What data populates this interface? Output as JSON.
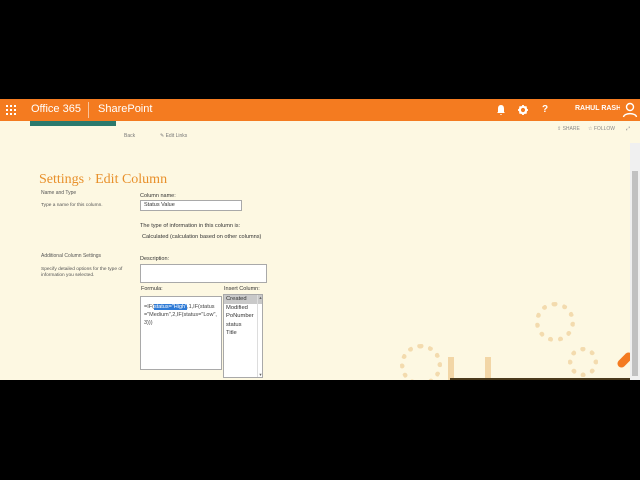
{
  "suitebar": {
    "brand": "Office 365",
    "app": "SharePoint",
    "user_name": "RAHUL RASHU",
    "icons": [
      "waffle-icon",
      "bell-icon",
      "gear-icon",
      "help-icon",
      "person-icon"
    ],
    "help_glyph": "?"
  },
  "actions": {
    "share": "SHARE",
    "follow": "FOLLOW"
  },
  "nav": {
    "back": "Back",
    "edit_links": "Edit Links"
  },
  "page": {
    "title_part1": "Settings",
    "separator": "›",
    "title_part2": "Edit Column"
  },
  "name_type": {
    "heading": "Name and Type",
    "description": "Type a name for this column.",
    "column_name_label": "Column name:",
    "column_name_value": "Status Value",
    "type_text": "The type of information in this column is:",
    "type_value": "Calculated (calculation based on other columns)"
  },
  "additional": {
    "heading": "Additional Column Settings",
    "description": "Specify detailed options for the type of information you selected.",
    "description_label": "Description:",
    "description_value": "",
    "formula_label": "Formula:",
    "formula_before": "=IF(",
    "formula_selected": "status=\"High\"",
    "formula_after": ",1,IF(status=\"Medium\",2,IF(status=\"Low\",3)))",
    "insert_column_label": "Insert Column:",
    "columns": [
      "Created",
      "Modified",
      "PoNumber",
      "status",
      "Title"
    ],
    "selected_column": "Created"
  },
  "colors": {
    "accent": "#f47b20",
    "title": "#e8902b",
    "background": "#fdf8e2"
  }
}
